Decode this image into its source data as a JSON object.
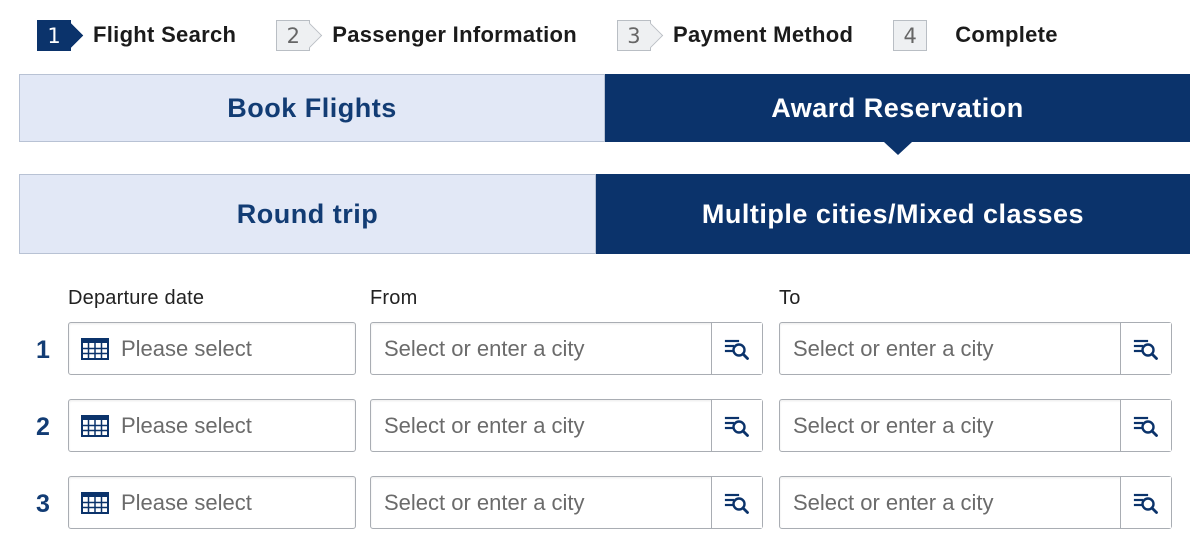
{
  "steps": [
    {
      "num": "1",
      "label": "Flight Search",
      "active": true
    },
    {
      "num": "2",
      "label": "Passenger Information",
      "active": false
    },
    {
      "num": "3",
      "label": "Payment Method",
      "active": false
    },
    {
      "num": "4",
      "label": "Complete",
      "active": false
    }
  ],
  "booking_tabs": {
    "book_flights": "Book Flights",
    "award_reservation": "Award Reservation",
    "selected": "award_reservation"
  },
  "trip_tabs": {
    "round_trip": "Round trip",
    "multi_city": "Multiple cities/Mixed classes",
    "selected": "multi_city"
  },
  "form": {
    "departure_label": "Departure date",
    "from_label": "From",
    "to_label": "To",
    "rows": [
      {
        "num": "1",
        "date_placeholder": "Please select",
        "from_placeholder": "Select or enter a city",
        "to_placeholder": "Select or enter a city"
      },
      {
        "num": "2",
        "date_placeholder": "Please select",
        "from_placeholder": "Select or enter a city",
        "to_placeholder": "Select or enter a city"
      },
      {
        "num": "3",
        "date_placeholder": "Please select",
        "from_placeholder": "Select or enter a city",
        "to_placeholder": "Select or enter a city"
      }
    ]
  },
  "icons": {
    "calendar": "calendar-icon",
    "city_lookup": "city-search-list-icon"
  },
  "colors": {
    "primary": "#0b336b",
    "inactive_tab": "#e2e8f6",
    "inactive_text": "#123c74"
  }
}
